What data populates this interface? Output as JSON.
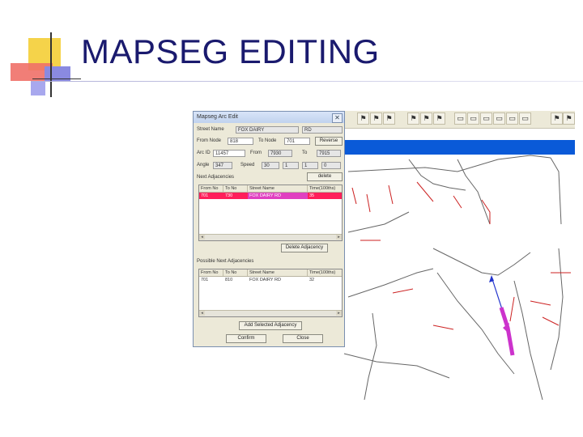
{
  "slide": {
    "title": "MAPSEG EDITING"
  },
  "colors": {
    "title": "#1a1a6e",
    "deco_yellow": "#f5d34a",
    "deco_red": "#e8584f",
    "deco_blue": "#6a6ad8",
    "selected_row": "#ff1f5a",
    "road_red": "#cc2222",
    "road_gray": "#555555",
    "segment_magenta": "#cc33cc",
    "segment_blue": "#2233cc",
    "toolbar_bg": "#ece9d8",
    "blue_bar": "#0a5ad8"
  },
  "toolbar": {
    "icons": [
      "map-tool-icon",
      "map-tool-icon",
      "map-tool-icon",
      "map-tool-icon",
      "map-tool-icon",
      "map-tool-icon",
      "map-tool-icon",
      "map-tool-icon",
      "map-tool-icon",
      "map-tool-icon",
      "map-tool-icon",
      "map-tool-icon",
      "map-tool-icon",
      "map-tool-icon",
      "map-tool-icon"
    ]
  },
  "dialog": {
    "title": "Mapseg Arc Edit",
    "close_label": "✕",
    "street_name_label": "Street Name",
    "street_name_value": "FOX DAIRY",
    "street_suffix_value": "RD",
    "from_node_label": "From Node",
    "from_node_value": "818",
    "to_node_label": "To Node",
    "to_node_value": "701",
    "reverse_label": "Reverse",
    "arc_id_label": "Arc ID",
    "arc_id_value": "11457",
    "from_label": "From",
    "from_value": "7930",
    "to_label": "To",
    "to_value": "7915",
    "angle_label": "Angle",
    "angle_value": "347",
    "speed_label": "Speed",
    "speed_value": "30",
    "speed_extra_1": "1",
    "speed_extra_2": "1",
    "speed_extra_3": "0",
    "next_adjacencies_label": "Next Adjacencies",
    "delete_label": "delete",
    "columns": [
      "From No",
      "To No",
      "Street Name",
      "Time(100ths)"
    ],
    "adjacency_rows": [
      {
        "from": "701",
        "to": "730",
        "street": "FOX DAIRY RD",
        "time": "35"
      }
    ],
    "delete_adjacency_label": "Delete Adjacency",
    "possible_next_label": "Possible Next Adjacencies",
    "possible_rows": [
      {
        "from": "701",
        "to": "810",
        "street": "FOX DAIRY RD",
        "time": "32"
      }
    ],
    "add_selected_label": "Add Selected Adjacency",
    "confirm_label": "Confirm",
    "close_button_label": "Close"
  }
}
